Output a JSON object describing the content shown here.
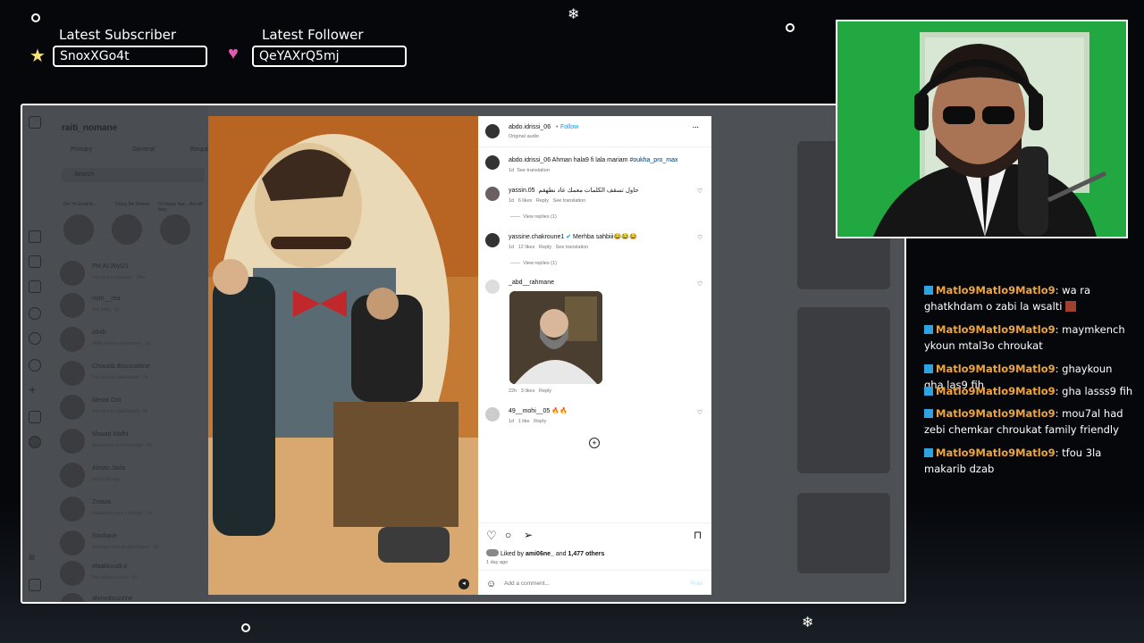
{
  "overlay": {
    "subscriber_label": "Latest Subscriber",
    "subscriber_name": "SnoxXGo4t",
    "follower_label": "Latest Follower",
    "follower_name": "QeYAXrQ5mj"
  },
  "instagram": {
    "account": "raiti_nomane",
    "tabs": [
      "Primary",
      "General",
      "Requests"
    ],
    "search_placeholder": "Search",
    "notes": [
      "Re: Hi Good to...",
      "Doing the Smime",
      "I'll Happy Nat... Are all they"
    ],
    "note_names": [
      "Your note",
      "",
      "Imad Benchakro"
    ],
    "dms": [
      {
        "name": "PH.AL06yi21",
        "sub": "You sent a message · 15m"
      },
      {
        "name": "nom__rea",
        "sub": "Say hello · 1h"
      },
      {
        "name": "a64b",
        "sub": "a64b sent an attachment · 2h"
      },
      {
        "name": "Chouaib Boussattine",
        "sub": "You sent an attachment · 3h"
      },
      {
        "name": "Mexat Oot",
        "sub": "You sent an attachment · 5h"
      },
      {
        "name": "Mouad Mafhi",
        "sub": "Reacted to your message · 6h"
      },
      {
        "name": "Aiman Jada",
        "sub": "Active 8m ago"
      },
      {
        "name": "Znowa",
        "sub": "Reacted to your message · 1d"
      },
      {
        "name": "Souhane",
        "sub": "Souhane sent an attachment · 1d"
      },
      {
        "name": "elaakkoudi.o",
        "sub": "You shared a post · 2d"
      },
      {
        "name": "ahmedouzzine",
        "sub": "..."
      }
    ]
  },
  "post": {
    "author": "abdo.idrissi_06",
    "follow_label": "Follow",
    "audio": "Original audio",
    "caption_user": "abdo.idrissi_06",
    "caption_text": "Ahman hala9 fi lala mariam",
    "caption_tag": "#oukha_pro_max",
    "caption_time": "1d",
    "see_translation": "See translation",
    "comments": [
      {
        "user": "yassin.05",
        "text": "حاول تسقف الكلمات معمك عاد نطهقم",
        "time": "1d",
        "likes": "6 likes",
        "reply": "Reply",
        "extra": "See translation",
        "view_replies": "View replies (1)"
      },
      {
        "user": "yassine.chakroune1",
        "text": "Merhba sahbiii😂😂😂",
        "time": "1d",
        "likes": "12 likes",
        "reply": "Reply",
        "extra": "See translation",
        "view_replies": "View replies (1)"
      },
      {
        "user": "_abd__rahmane",
        "text": "",
        "time": "22h",
        "likes": "3 likes",
        "reply": "Reply",
        "extra": "",
        "view_replies": ""
      },
      {
        "user": "49__mohi__05",
        "text": "🔥🔥",
        "time": "1d",
        "likes": "1 like",
        "reply": "Reply",
        "extra": "",
        "view_replies": ""
      }
    ],
    "liked_by_prefix": "Liked by",
    "liked_by_user": "ami06ne_",
    "liked_by_rest": "and",
    "liked_by_count": "1,477 others",
    "date": "1 day ago",
    "comment_placeholder": "Add a comment...",
    "post_button": "Post"
  },
  "chat": [
    {
      "name": "Matlo9Matlo9Matlo9",
      "text": ": wa ra ghatkhdam o zabi la wsalti"
    },
    {
      "name": "Matlo9Matlo9Matlo9",
      "text": ": maymkench ykoun mtal3o chroukat"
    },
    {
      "name": "Matlo9Matlo9Matlo9",
      "text": ": ghaykoun gha las9 fih"
    },
    {
      "name": "Matlo9Matlo9Matlo9",
      "text": ": gha lasss9 fih"
    },
    {
      "name": "Matlo9Matlo9Matlo9",
      "text": ": mou7al had zebi chemkar chroukat family friendly"
    },
    {
      "name": "Matlo9Matlo9Matlo9",
      "text": ": tfou 3la makarib dzab"
    }
  ],
  "colors": {
    "accent": "#f0a53c",
    "background": "#05070b",
    "badge": "#2fa3e0",
    "link": "#0095f6"
  }
}
